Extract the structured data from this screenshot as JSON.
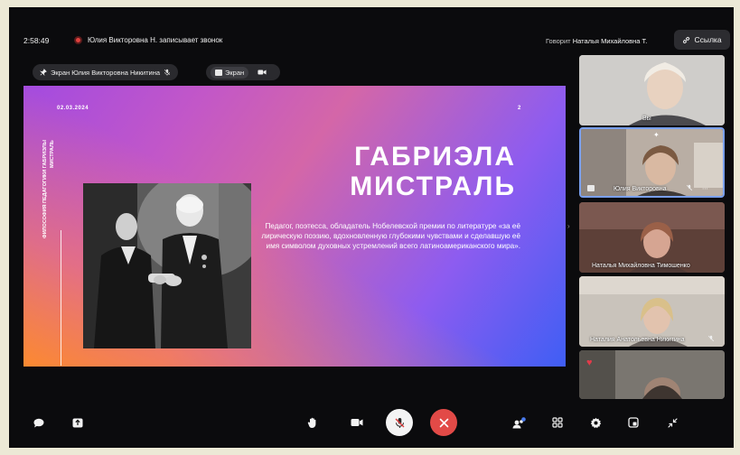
{
  "call": {
    "timer": "2:58:49",
    "recording_text": "Юлия Викторовна Н. записывает звонок",
    "speaker_prefix": "Говорит",
    "speaker_name": "Наталья Михайловна Т.",
    "link_label": "Ссылка"
  },
  "share": {
    "user_chip_label": "Экран Юлия Викторовна Никитина",
    "screen_chip_label": "Экран"
  },
  "slide": {
    "date": "02.03.2024",
    "page": "2",
    "vertical_text": "ФИЛОСОФИЯ ПЕДАГОГИКИ ГАБРИЭЛЫ МИСТРАЛЬ",
    "title_line1": "ГАБРИЭЛА",
    "title_line2": "МИСТРАЛЬ",
    "description": "Педагог, поэтесса, обладатель Нобелевской премии по литературе «за её лирическую поэзию, вдохновленную глубокими чувствами и сделавшую её имя символом духовных устремлений всего латиноамериканского мира»."
  },
  "participants": [
    {
      "name": "Вы"
    },
    {
      "name": "Юлия Викторовна"
    },
    {
      "name": "Наталья Михайловна Тимошенко"
    },
    {
      "name": "Наталия Анатольевна Никитина"
    },
    {
      "name": ""
    }
  ],
  "colors": {
    "frame_bg": "#0b0b0d",
    "record_red": "#e0413e",
    "end_call_red": "#e24a47",
    "accent_blue": "#4a7cf0"
  },
  "toolbar": {
    "icons": [
      "chat-icon",
      "share-screen-icon",
      "raise-hand-icon",
      "camera-icon",
      "mic-muted-icon",
      "end-call-icon",
      "participants-icon",
      "grid-icon",
      "settings-icon",
      "pip-icon",
      "collapse-icon"
    ]
  }
}
